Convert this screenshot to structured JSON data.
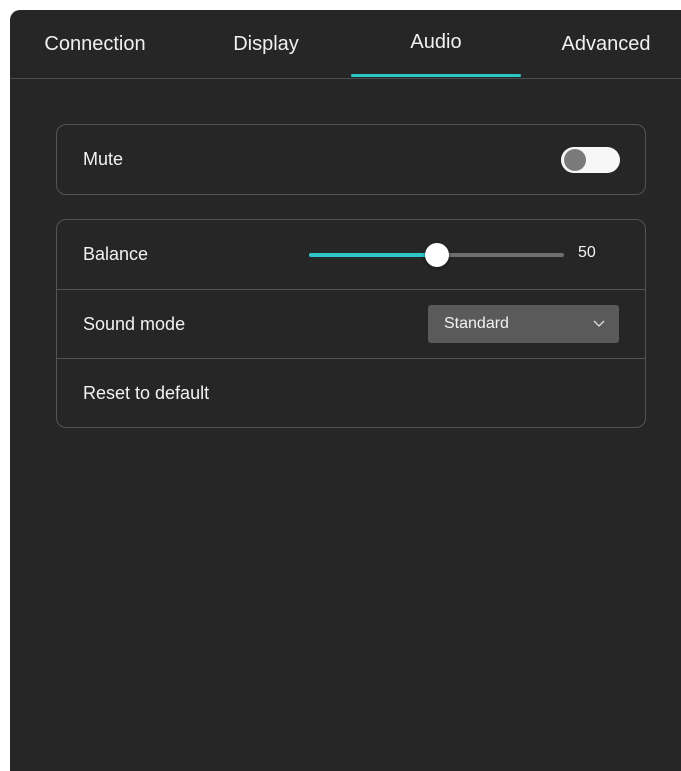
{
  "tabs": [
    {
      "label": "Connection",
      "active": false
    },
    {
      "label": "Display",
      "active": false
    },
    {
      "label": "Audio",
      "active": true
    },
    {
      "label": "Advanced",
      "active": false
    }
  ],
  "mute": {
    "label": "Mute",
    "enabled": false
  },
  "balance": {
    "label": "Balance",
    "value": "50",
    "min": 0,
    "max": 100
  },
  "sound_mode": {
    "label": "Sound mode",
    "selected": "Standard"
  },
  "reset": {
    "label": "Reset to default"
  },
  "colors": {
    "accent": "#2cc6c6",
    "background": "#262626",
    "border": "#545454"
  }
}
